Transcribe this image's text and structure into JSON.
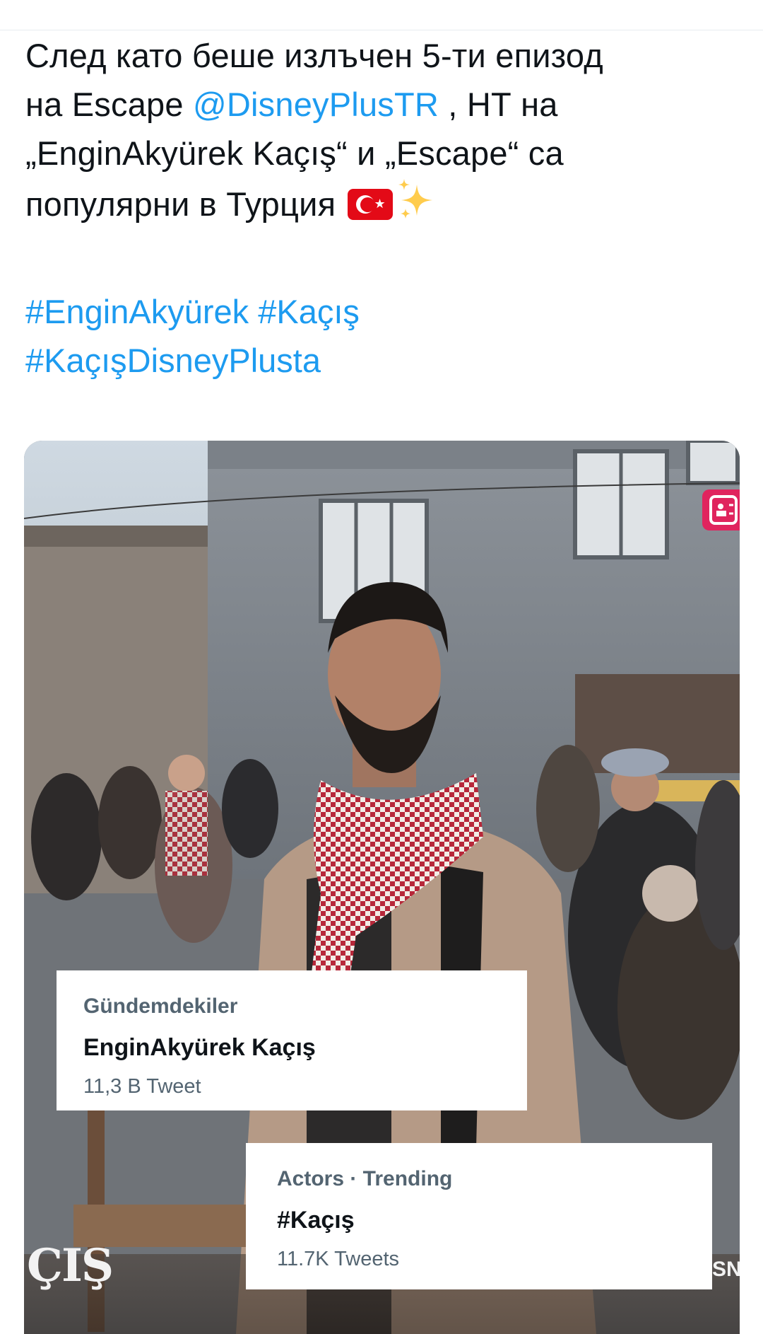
{
  "tweet": {
    "line1": "След като беше излъчен 5-ти епизод",
    "line2_prefix": "на Escape ",
    "mention": "@DisneyPlusTR",
    "line2_suffix": " , НТ на",
    "line3": " „EnginAkyürek Kaçış“ и „Escape“ са",
    "line4": "популярни в Турция ",
    "flag_icon": "turkey-flag-icon",
    "sparkles_icon": "sparkles-icon",
    "hashtags": {
      "tag1": "#EnginAkyürek",
      "tag2": "#Kaçış",
      "tag3": "#KaçışDisneyPlusta"
    },
    "link_color": "#1d9bf0"
  },
  "media": {
    "trend_card_tr": {
      "label": "Gündemdekiler",
      "topic": "EnginAkyürek Kaçış",
      "count": "11,3 B Tweet"
    },
    "trend_card_en": {
      "label": "Actors · Trending",
      "topic": "#Kaçış",
      "count": "11.7K Tweets"
    },
    "logo_left": "ÇIŞ",
    "logo_right": "SN",
    "badge_icon": "lock-icon",
    "badge_color": "#e0245e"
  }
}
